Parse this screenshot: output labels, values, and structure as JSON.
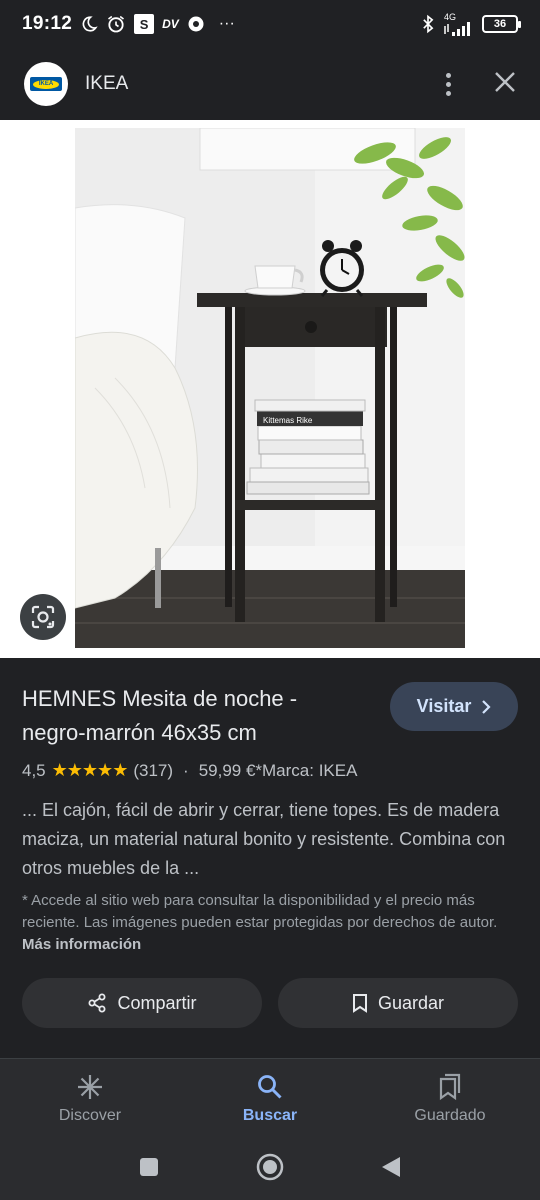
{
  "status_bar": {
    "time": "19:12",
    "s_badge": "S",
    "dv_label": "DV",
    "more": "···",
    "network": "4G",
    "battery": "36"
  },
  "header": {
    "title": "IKEA",
    "logo_text": "IKEA"
  },
  "product": {
    "title": "HEMNES Mesita de noche - negro-marrón 46x35 cm",
    "rating": "4,5",
    "stars": "★★★★★",
    "reviews": "(317)",
    "separator": "·",
    "price_brand": "59,99 €*Marca: IKEA",
    "description": "... El cajón, fácil de abrir y cerrar, tiene topes. Es de madera maciza, un material natural bonito y resistente. Combina con otros muebles de la ...",
    "note": "* Accede al sitio web para consultar la disponibilidad y el precio más reciente. Las imágenes pueden estar protegidas por derechos de autor.",
    "note_link": "Más información",
    "book_spine_text": "Kittemas Rike"
  },
  "actions": {
    "visit": "Visitar",
    "share": "Compartir",
    "save": "Guardar"
  },
  "bottom_nav": {
    "items": [
      {
        "label": "Discover",
        "icon": "asterisk-icon",
        "active": false
      },
      {
        "label": "Buscar",
        "icon": "search-icon",
        "active": true
      },
      {
        "label": "Guardado",
        "icon": "bookmarks-icon",
        "active": false
      }
    ]
  },
  "colors": {
    "background": "#202124",
    "accent": "#8ab4f8",
    "visit_button": "#394457",
    "star": "#fbbc04"
  }
}
